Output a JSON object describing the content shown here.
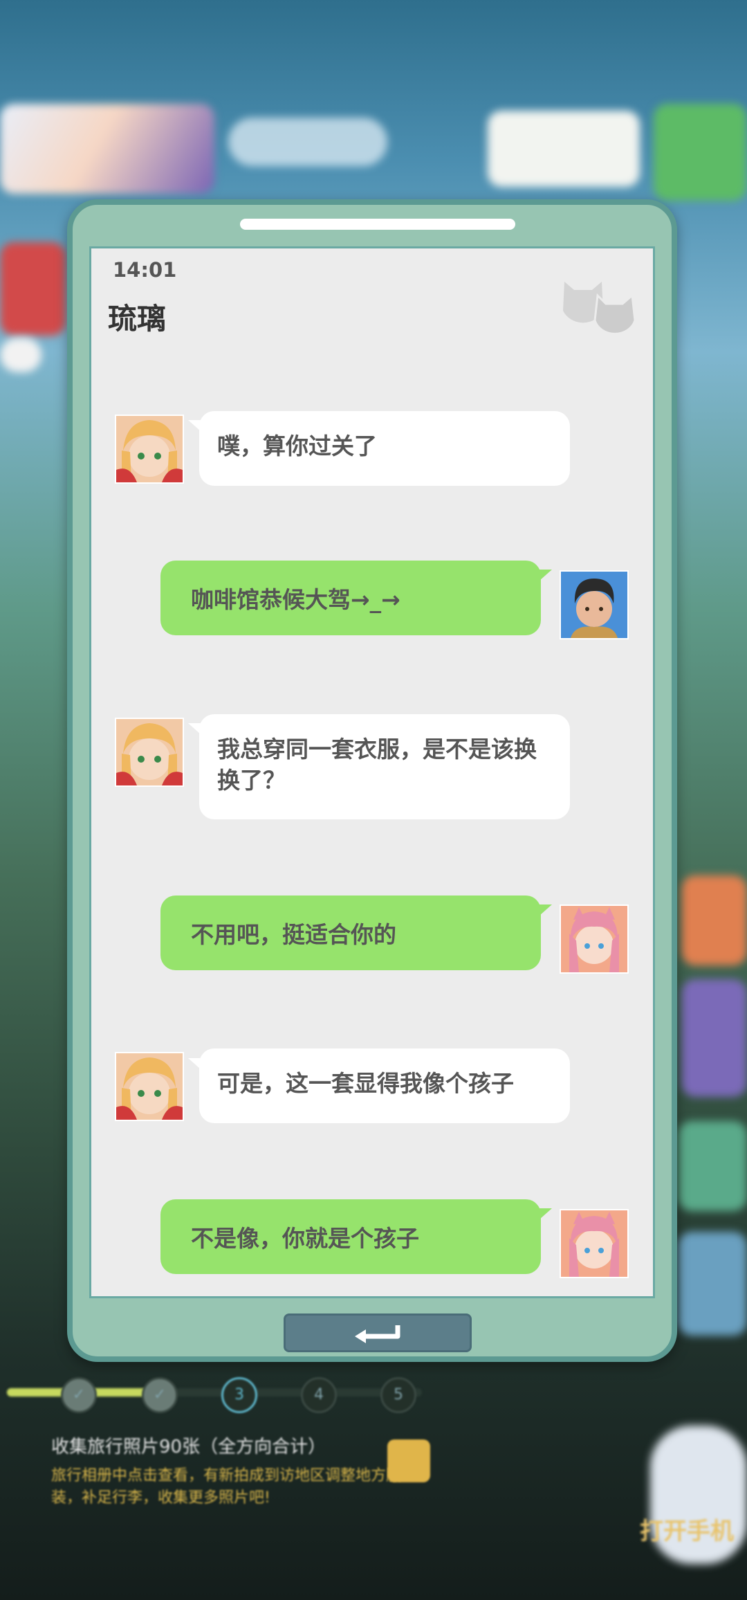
{
  "background": {
    "task": {
      "title": "收集旅行照片90张（全方向合计）",
      "desc": "旅行相册中点击查看，有新拍成到访地区调整地方服装，补足行李，收集更多照片吧!"
    },
    "steps": [
      "3",
      "4",
      "5"
    ],
    "open_phone_label": "打开手机",
    "progress_steps_completed": 2
  },
  "phone": {
    "status_time": "14:01",
    "chat_title": "琉璃",
    "messages": [
      {
        "side": "in",
        "avatar": "girl-blonde-avatar",
        "text": "噗，算你过关了"
      },
      {
        "side": "out",
        "avatar": "boy-avatar",
        "text": "咖啡馆恭候大驾→_→"
      },
      {
        "side": "in",
        "avatar": "girl-blonde-avatar",
        "text": "我总穿同一套衣服，是不是该换换了？"
      },
      {
        "side": "out",
        "avatar": "girl-pink-avatar",
        "text": "不用吧，挺适合你的"
      },
      {
        "side": "in",
        "avatar": "girl-blonde-avatar",
        "text": "可是，这一套显得我像个孩子"
      },
      {
        "side": "out",
        "avatar": "girl-pink-avatar",
        "text": "不是像，你就是个孩子"
      }
    ],
    "back_button_icon": "return-arrow-icon"
  },
  "colors": {
    "incoming_bubble": "#ffffff",
    "outgoing_bubble": "#96e36c",
    "screen_bg": "#ececec",
    "phone_frame": "#97c5b2"
  }
}
